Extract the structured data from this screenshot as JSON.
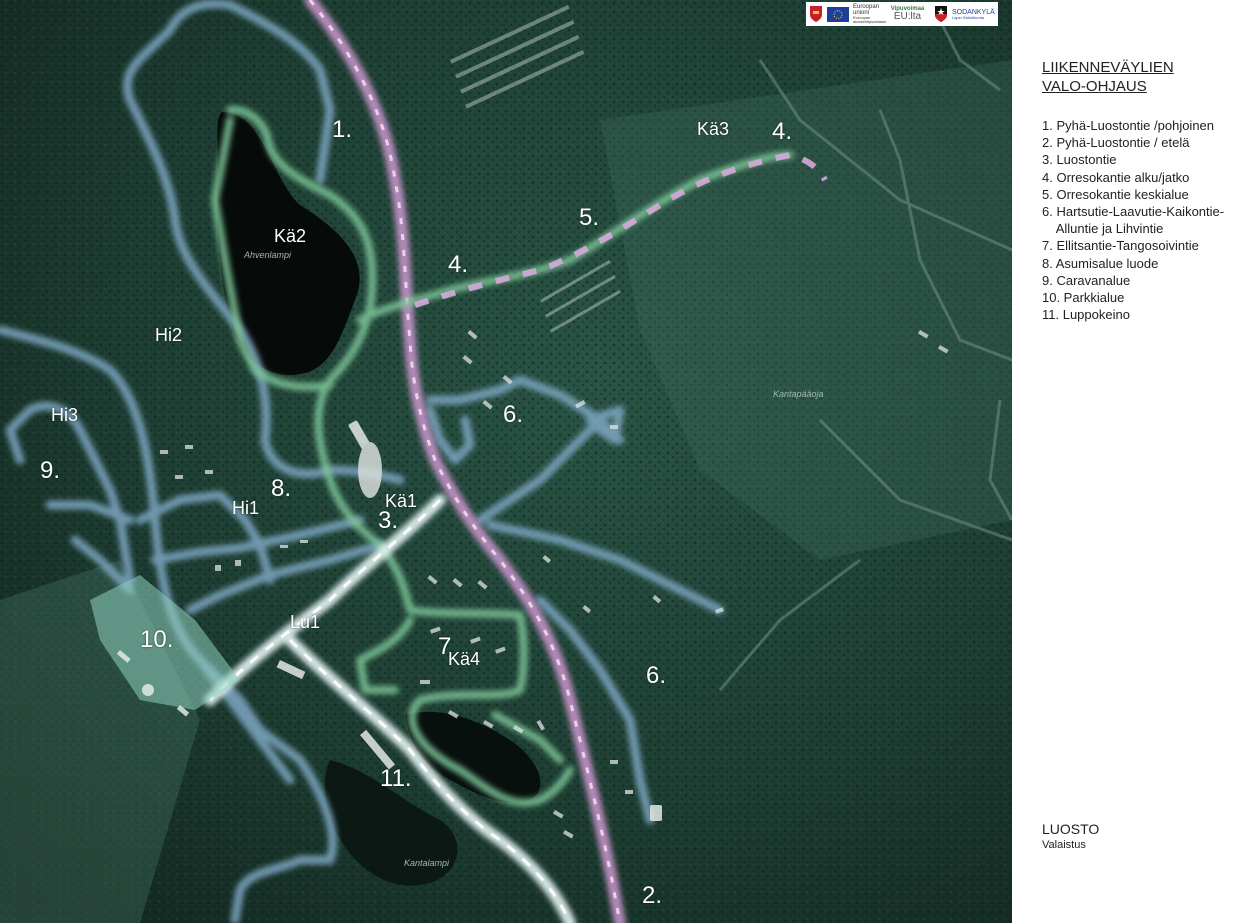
{
  "map": {
    "labels": {
      "n1": "1.",
      "n2": "2.",
      "n3": "3.",
      "n4a": "4.",
      "n4b": "4.",
      "n5": "5.",
      "n6a": "6.",
      "n6b": "6.",
      "n7": "7",
      "n8": "8.",
      "n9": "9.",
      "n10": "10.",
      "n11": "11.",
      "ka1": "Kä1",
      "ka2": "Kä2",
      "ka3": "Kä3",
      "ka4": "Kä4",
      "hi1": "Hi1",
      "hi2": "Hi2",
      "hi3": "Hi3",
      "lu1": "Lu1"
    },
    "place_names": {
      "ahvenlampi": "Ahvenlampi",
      "kantalampi": "Kantalampi",
      "kantapaaoja": "Kantapääoja"
    }
  },
  "logos": {
    "eu_text": "Euroopan unioni",
    "eu_sub": "Euroopan aluekehitysrahasto",
    "vipuvoimaa": "Vipuvoimaa",
    "euilta": "EU:lta",
    "sodankyla": "SODANKYLÄ",
    "sodankyla_sub": "Lapin Sähkökunta"
  },
  "legend": {
    "title_line1": "LIIKENNEVÄYLIEN",
    "title_line2": "VALO-OHJAUS",
    "items": [
      "1. Pyhä-Luostontie /pohjoinen",
      "2. Pyhä-Luostontie / etelä",
      "3. Luostontie",
      "4. Orresokantie alku/jatko",
      "5. Orresokantie keskialue",
      "6. Hartsutie-Laavutie-Kaikontie-",
      "    Alluntie ja Lihvintie",
      "7. Ellitsantie-Tangosoivintie",
      "8. Asumisalue luode",
      "9. Caravanalue",
      "10. Parkkialue",
      "11. Luppokeino"
    ],
    "place": "LUOSTO",
    "place_sub": "Valaistus"
  },
  "colors": {
    "forest": "#1c3a30",
    "blue_route": "#7fa7c4",
    "green_route": "#7fc89a",
    "purple_route": "#c592c8",
    "white_route": "#e6f4f4"
  }
}
